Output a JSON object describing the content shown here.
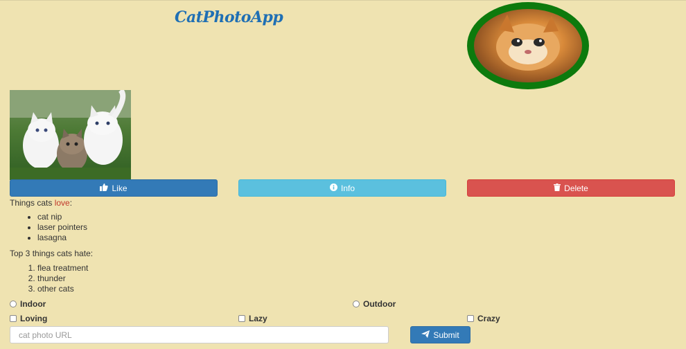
{
  "header": {
    "title": "CatPhotoApp"
  },
  "buttons": {
    "like": {
      "label": "Like",
      "icon": "thumbs-up-icon"
    },
    "info": {
      "label": "Info",
      "icon": "info-circle-icon"
    },
    "delete": {
      "label": "Delete",
      "icon": "trash-icon"
    }
  },
  "love_section": {
    "prefix": "Things cats ",
    "highlight": "love",
    "suffix": ":",
    "items": [
      "cat nip",
      "laser pointers",
      "lasagna"
    ]
  },
  "hate_section": {
    "heading": "Top 3 things cats hate:",
    "items": [
      "flea treatment",
      "thunder",
      "other cats"
    ]
  },
  "radios": [
    {
      "label": "Indoor",
      "checked": false
    },
    {
      "label": "Outdoor",
      "checked": false
    }
  ],
  "checkboxes": [
    {
      "label": "Loving",
      "checked": false
    },
    {
      "label": "Lazy",
      "checked": false
    },
    {
      "label": "Crazy",
      "checked": false
    }
  ],
  "form": {
    "url_placeholder": "cat photo URL",
    "url_value": "",
    "submit_label": "Submit",
    "submit_icon": "paper-plane-icon"
  },
  "colors": {
    "background": "#efe3b1",
    "title": "#1f6fb4",
    "like": "#337ab7",
    "info": "#5bc0de",
    "delete": "#d9534f",
    "avatar_ring": "#0d7a0d",
    "love_highlight": "#c0392b"
  }
}
